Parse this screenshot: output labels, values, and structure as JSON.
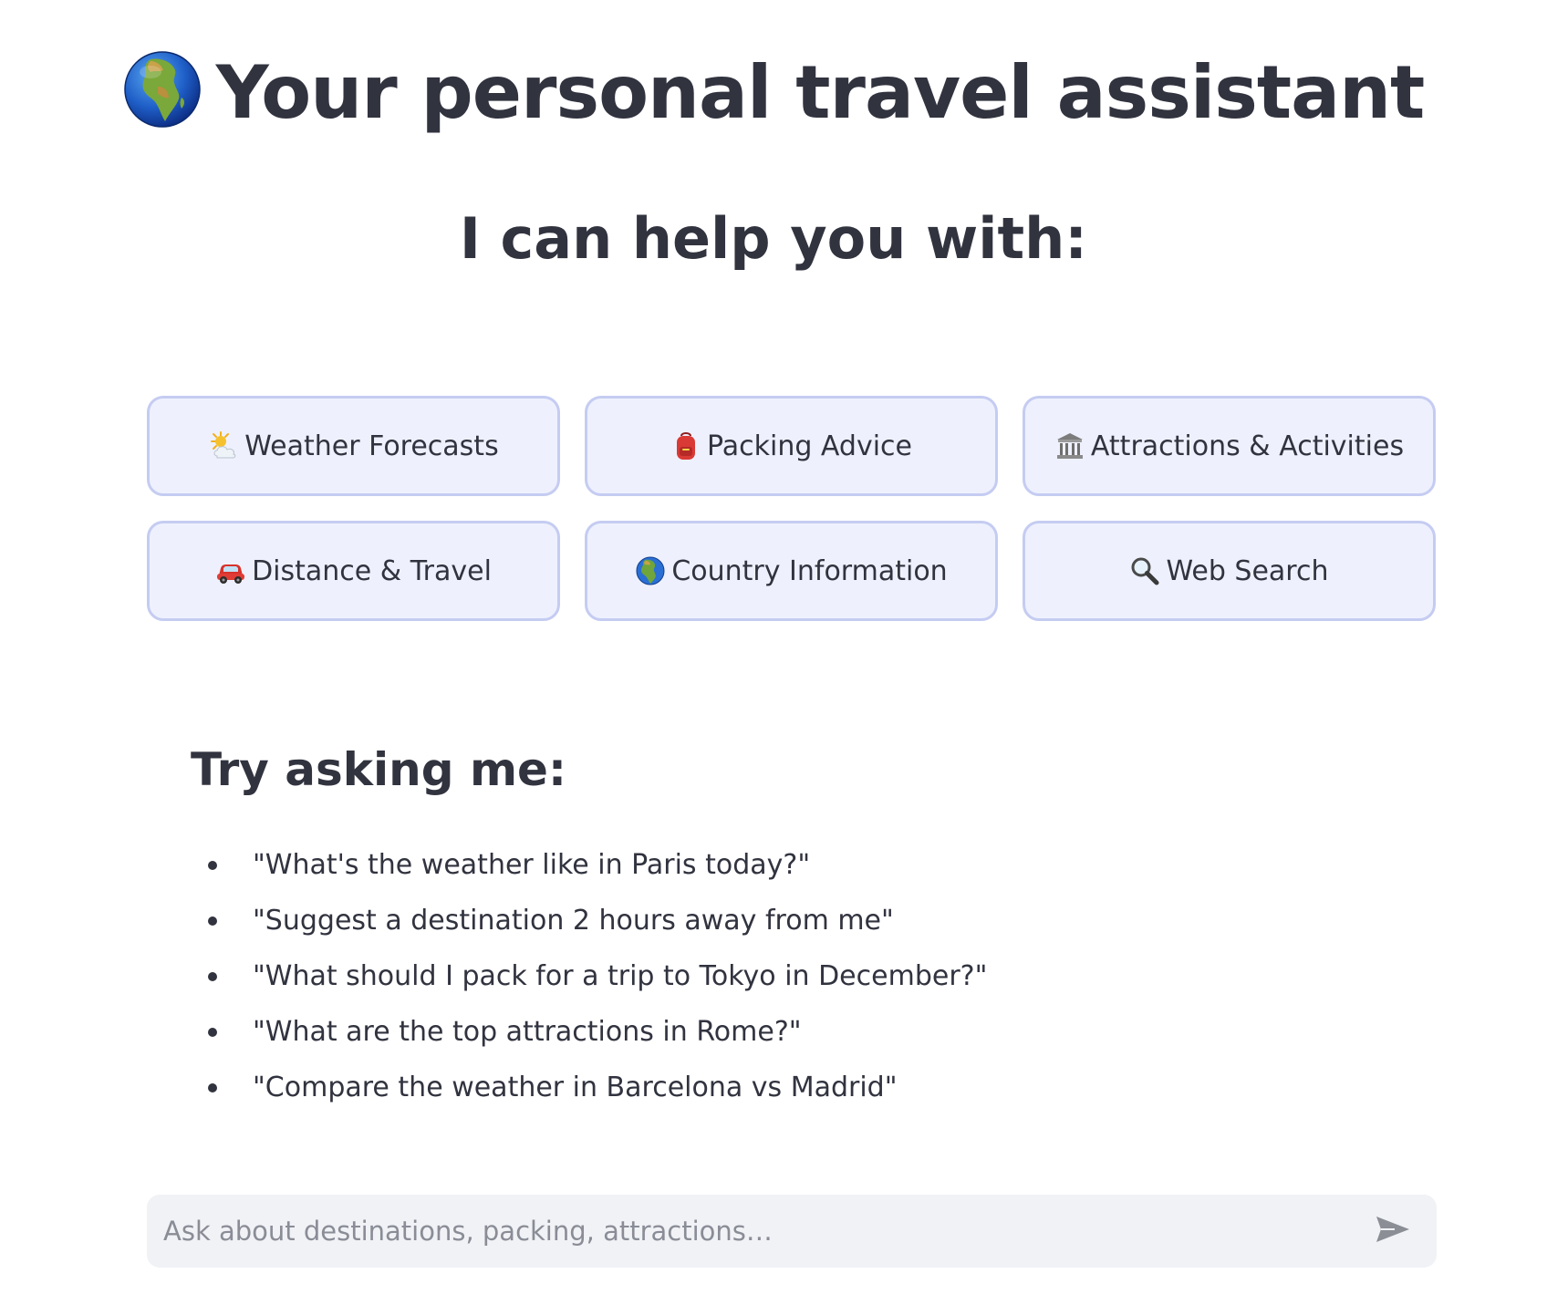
{
  "header": {
    "globe_icon": "earth-africa-globe-icon",
    "title": "Your personal travel assistant",
    "subtitle": "I can help you with:"
  },
  "features": [
    {
      "icon": "sun-behind-cloud-icon",
      "label": "Weather Forecasts"
    },
    {
      "icon": "backpack-icon",
      "label": "Packing Advice"
    },
    {
      "icon": "classical-building-icon",
      "label": "Attractions & Activities"
    },
    {
      "icon": "red-car-icon",
      "label": "Distance & Travel"
    },
    {
      "icon": "earth-globe-icon",
      "label": "Country Information"
    },
    {
      "icon": "magnifying-glass-icon",
      "label": "Web Search"
    }
  ],
  "examples": {
    "heading": "Try asking me:",
    "items": [
      "\"What's the weather like in Paris today?\"",
      "\"Suggest a destination 2 hours away from me\"",
      "\"What should I pack for a trip to Tokyo in December?\"",
      "\"What are the top attractions in Rome?\"",
      "\"Compare the weather in Barcelona vs Madrid\""
    ]
  },
  "chat": {
    "placeholder": "Ask about destinations, packing, attractions…",
    "send_icon": "send-arrow-icon"
  },
  "colors": {
    "text": "#31333f",
    "button_bg": "#eef1fd",
    "button_border": "#c5ccf2",
    "chat_bg": "#f0f2f6"
  }
}
